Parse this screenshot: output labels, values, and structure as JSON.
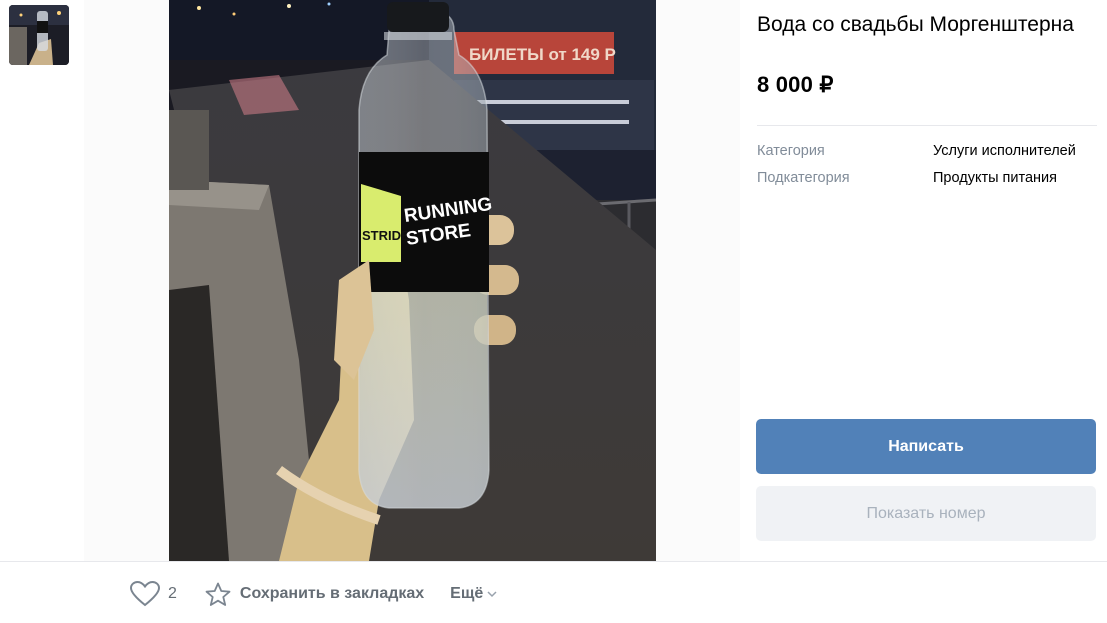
{
  "thumbnail": {
    "alt": "Фото товара"
  },
  "photo": {
    "label_brand_1": "STRIDE",
    "label_brand_2": "RUNNING",
    "label_brand_3": "STORE",
    "background_sign": "БИЛЕТЫ от 149 Р"
  },
  "product": {
    "title": "Вода со свадьбы Моргенштерна",
    "price": "8 000 ₽"
  },
  "properties": [
    {
      "key": "Категория",
      "value": "Услуги исполнителей"
    },
    {
      "key": "Подкатегория",
      "value": "Продукты питания"
    }
  ],
  "buttons": {
    "write": "Написать",
    "show_number": "Показать номер"
  },
  "actions": {
    "like_count": "2",
    "save_label": "Сохранить в закладках",
    "more_label": "Ещё"
  },
  "colors": {
    "accent": "#5181b8",
    "muted_text": "#818c99",
    "action_text": "#656d75",
    "disabled_bg": "#f0f2f5"
  },
  "icons": [
    "heart-icon",
    "star-icon",
    "chevron-down-icon"
  ]
}
